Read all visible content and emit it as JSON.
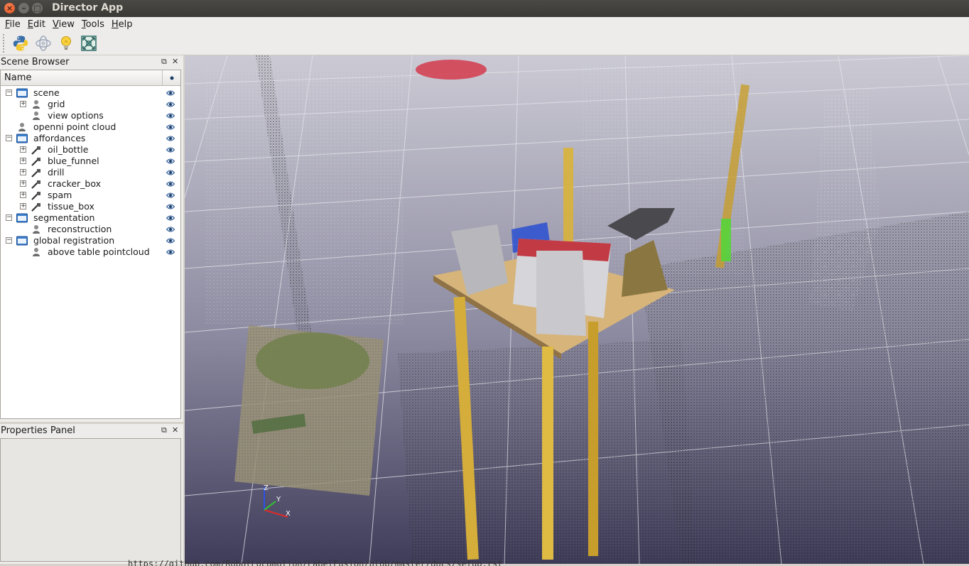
{
  "window": {
    "title": "Director App",
    "controls": [
      "×",
      "–",
      "□"
    ]
  },
  "menu": [
    {
      "label": "File",
      "accel": "F",
      "rest": "ile"
    },
    {
      "label": "Edit",
      "accel": "E",
      "rest": "dit"
    },
    {
      "label": "View",
      "accel": "V",
      "rest": "iew"
    },
    {
      "label": "Tools",
      "accel": "T",
      "rest": "ools"
    },
    {
      "label": "Help",
      "accel": "H",
      "rest": "elp"
    }
  ],
  "toolbar": {
    "buttons": [
      "python-icon",
      "camera-orbit-icon",
      "lightbulb-icon",
      "fit-view-icon"
    ]
  },
  "scene_browser": {
    "title": "Scene Browser",
    "column_name": "Name",
    "items": [
      {
        "label": "scene",
        "type": "folder",
        "depth": 0,
        "expanded": true
      },
      {
        "label": "grid",
        "type": "object",
        "depth": 1,
        "expandable": true
      },
      {
        "label": "view options",
        "type": "object",
        "depth": 1,
        "expandable": false
      },
      {
        "label": "openni point cloud",
        "type": "object",
        "depth": 0,
        "expandable": false
      },
      {
        "label": "affordances",
        "type": "folder",
        "depth": 0,
        "expanded": true
      },
      {
        "label": "oil_bottle",
        "type": "affordance",
        "depth": 1,
        "expandable": true
      },
      {
        "label": "blue_funnel",
        "type": "affordance",
        "depth": 1,
        "expandable": true
      },
      {
        "label": "drill",
        "type": "affordance",
        "depth": 1,
        "expandable": true
      },
      {
        "label": "cracker_box",
        "type": "affordance",
        "depth": 1,
        "expandable": true
      },
      {
        "label": "spam",
        "type": "affordance",
        "depth": 1,
        "expandable": true
      },
      {
        "label": "tissue_box",
        "type": "affordance",
        "depth": 1,
        "expandable": true
      },
      {
        "label": "segmentation",
        "type": "folder",
        "depth": 0,
        "expanded": true
      },
      {
        "label": "reconstruction",
        "type": "object",
        "depth": 1,
        "expandable": false
      },
      {
        "label": "global registration",
        "type": "folder",
        "depth": 0,
        "expanded": true
      },
      {
        "label": "above table pointcloud",
        "type": "object",
        "depth": 1,
        "expandable": false
      }
    ]
  },
  "properties_panel": {
    "title": "Properties Panel"
  },
  "viewport": {
    "axes": {
      "x": "X",
      "y": "Y",
      "z": "Z"
    },
    "background_top": "#c9c8d3",
    "background_bottom": "#3f3c5a"
  },
  "status_text": "https://github.com/RobotLocomotion/LabelFusion/blob/master/docs/setup.rst",
  "colors": {
    "accent_orange": "#e2501c",
    "folder_blue": "#3b7fd0",
    "table_yellow": "#d9b23a"
  }
}
